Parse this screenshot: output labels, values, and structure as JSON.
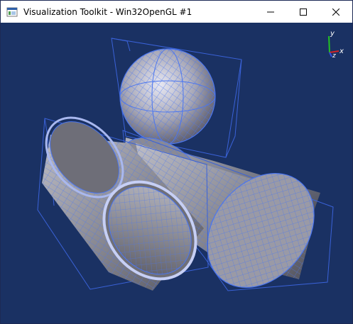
{
  "window": {
    "title": "Visualization Toolkit - Win32OpenGL #1",
    "icons": {
      "app": "vtk-window-icon",
      "minimize": "minimize-icon",
      "maximize": "maximize-icon",
      "close": "close-icon"
    }
  },
  "viewport": {
    "background_color": "#1a3163",
    "wireframe_color": "#3a62d8",
    "surface_color": "#8f8f96",
    "objects": [
      "sphere",
      "cylinder",
      "cylinder",
      "cylinder"
    ]
  },
  "axes": {
    "y_label": "y",
    "x_label": "x",
    "z_label": "z",
    "y_color": "#22c322",
    "x_color": "#d42323",
    "z_color": "#2f4fe6"
  }
}
